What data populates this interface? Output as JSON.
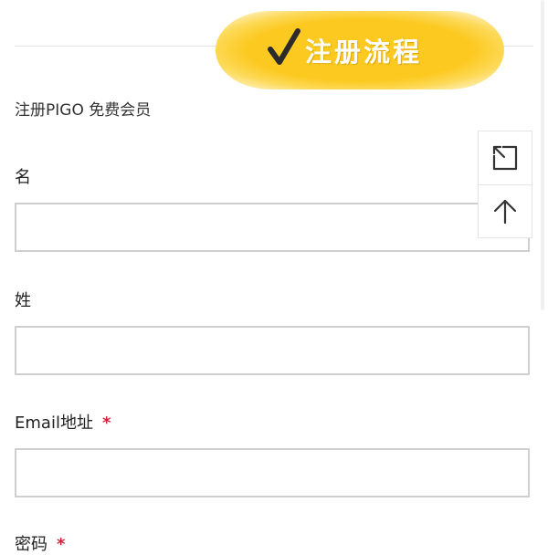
{
  "banner": {
    "title": "注册流程"
  },
  "intro": {
    "text": "注册PIGO 免费会员"
  },
  "form": {
    "fields": [
      {
        "label": "名",
        "required": false,
        "value": ""
      },
      {
        "label": "姓",
        "required": false,
        "value": ""
      },
      {
        "label": "Email地址",
        "required": true,
        "value": ""
      },
      {
        "label": "密码",
        "required": true,
        "value": ""
      }
    ],
    "required_mark": "*"
  },
  "tools": [
    {
      "icon": "collapse-expand-icon"
    },
    {
      "icon": "arrow-up-icon"
    }
  ],
  "colors": {
    "banner": "#fcc920",
    "required": "#d0243c",
    "border": "#cfcfcf"
  }
}
